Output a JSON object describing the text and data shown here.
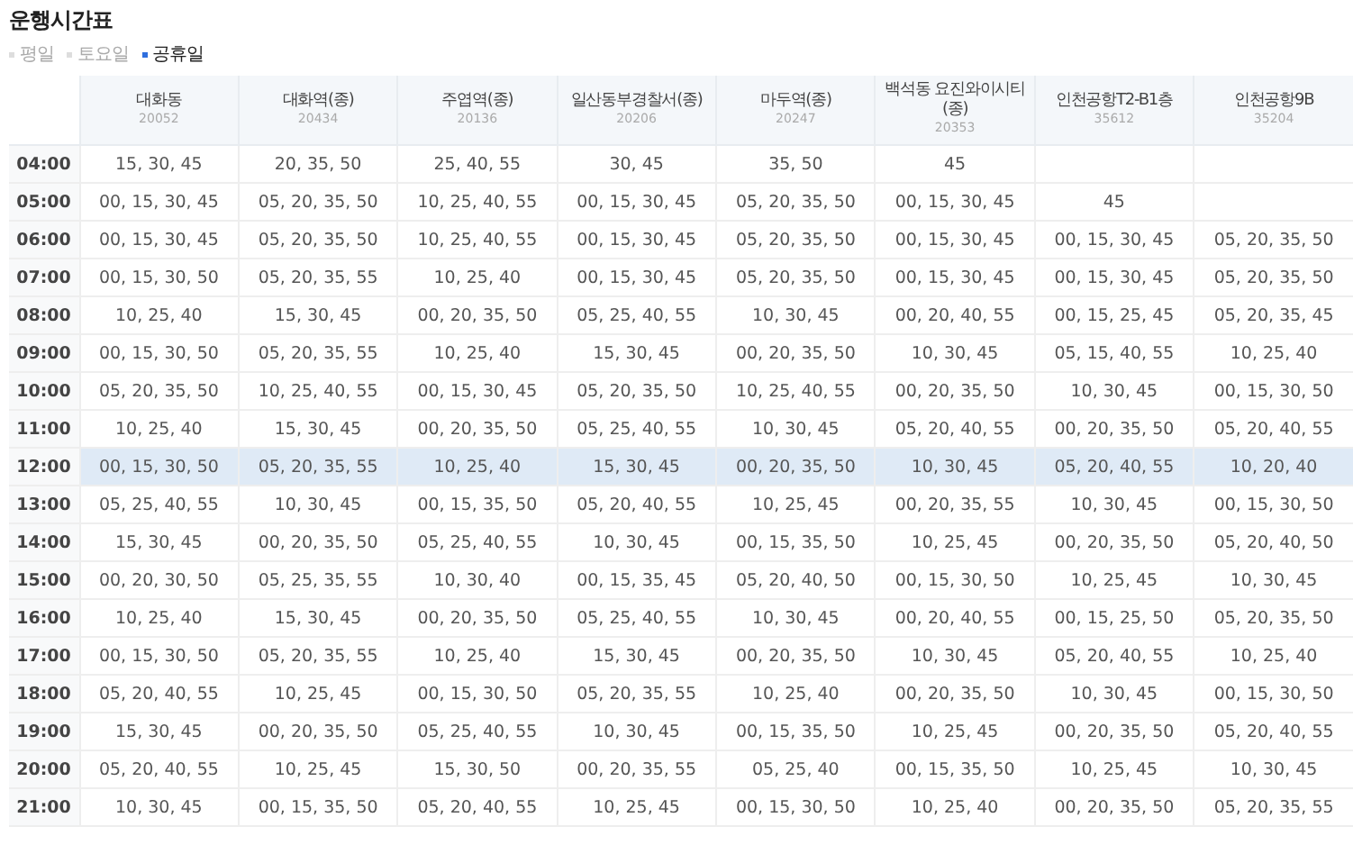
{
  "title": "운행시간표",
  "day_types": [
    {
      "label": "평일",
      "selected": false
    },
    {
      "label": "토요일",
      "selected": false
    },
    {
      "label": "공휴일",
      "selected": true
    }
  ],
  "table": {
    "columns": [
      {
        "name": "대화동",
        "stop_id": "20052"
      },
      {
        "name": "대화역(종)",
        "stop_id": "20434"
      },
      {
        "name": "주엽역(종)",
        "stop_id": "20136"
      },
      {
        "name": "일산동부경찰서(종)",
        "stop_id": "20206"
      },
      {
        "name": "마두역(종)",
        "stop_id": "20247"
      },
      {
        "name": "백석동 요진와이시티(종)",
        "stop_id": "20353"
      },
      {
        "name": "인천공항T2-B1층",
        "stop_id": "35612"
      },
      {
        "name": "인천공항9B",
        "stop_id": "35204"
      }
    ],
    "rows": [
      {
        "time": "04:00",
        "highlighted": false,
        "cells": [
          "15, 30, 45",
          "20, 35, 50",
          "25, 40, 55",
          "30, 45",
          "35, 50",
          "45",
          null,
          null
        ]
      },
      {
        "time": "05:00",
        "highlighted": false,
        "cells": [
          "00, 15, 30, 45",
          "05, 20, 35, 50",
          "10, 25, 40, 55",
          "00, 15, 30, 45",
          "05, 20, 35, 50",
          "00, 15, 30, 45",
          "45",
          null
        ]
      },
      {
        "time": "06:00",
        "highlighted": false,
        "cells": [
          "00, 15, 30, 45",
          "05, 20, 35, 50",
          "10, 25, 40, 55",
          "00, 15, 30, 45",
          "05, 20, 35, 50",
          "00, 15, 30, 45",
          "00, 15, 30, 45",
          "05, 20, 35, 50"
        ]
      },
      {
        "time": "07:00",
        "highlighted": false,
        "cells": [
          "00, 15, 30, 50",
          "05, 20, 35, 55",
          "10, 25, 40",
          "00, 15, 30, 45",
          "05, 20, 35, 50",
          "00, 15, 30, 45",
          "00, 15, 30, 45",
          "05, 20, 35, 50"
        ]
      },
      {
        "time": "08:00",
        "highlighted": false,
        "cells": [
          "10, 25, 40",
          "15, 30, 45",
          "00, 20, 35, 50",
          "05, 25, 40, 55",
          "10, 30, 45",
          "00, 20, 40, 55",
          "00, 15, 25, 45",
          "05, 20, 35, 45"
        ]
      },
      {
        "time": "09:00",
        "highlighted": false,
        "cells": [
          "00, 15, 30, 50",
          "05, 20, 35, 55",
          "10, 25, 40",
          "15, 30, 45",
          "00, 20, 35, 50",
          "10, 30, 45",
          "05, 15, 40, 55",
          "10, 25, 40"
        ]
      },
      {
        "time": "10:00",
        "highlighted": false,
        "cells": [
          "05, 20, 35, 50",
          "10, 25, 40, 55",
          "00, 15, 30, 45",
          "05, 20, 35, 50",
          "10, 25, 40, 55",
          "00, 20, 35, 50",
          "10, 30, 45",
          "00, 15, 30, 50"
        ]
      },
      {
        "time": "11:00",
        "highlighted": false,
        "cells": [
          "10, 25, 40",
          "15, 30, 45",
          "00, 20, 35, 50",
          "05, 25, 40, 55",
          "10, 30, 45",
          "05, 20, 40, 55",
          "00, 20, 35, 50",
          "05, 20, 40, 55"
        ]
      },
      {
        "time": "12:00",
        "highlighted": true,
        "cells": [
          "00, 15, 30, 50",
          "05, 20, 35, 55",
          "10, 25, 40",
          "15, 30, 45",
          "00, 20, 35, 50",
          "10, 30, 45",
          "05, 20, 40, 55",
          "10, 20, 40"
        ]
      },
      {
        "time": "13:00",
        "highlighted": false,
        "cells": [
          "05, 25, 40, 55",
          "10, 30, 45",
          "00, 15, 35, 50",
          "05, 20, 40, 55",
          "10, 25, 45",
          "00, 20, 35, 55",
          "10, 30, 45",
          "00, 15, 30, 50"
        ]
      },
      {
        "time": "14:00",
        "highlighted": false,
        "cells": [
          "15, 30, 45",
          "00, 20, 35, 50",
          "05, 25, 40, 55",
          "10, 30, 45",
          "00, 15, 35, 50",
          "10, 25, 45",
          "00, 20, 35, 50",
          "05, 20, 40, 50"
        ]
      },
      {
        "time": "15:00",
        "highlighted": false,
        "cells": [
          "00, 20, 30, 50",
          "05, 25, 35, 55",
          "10, 30, 40",
          "00, 15, 35, 45",
          "05, 20, 40, 50",
          "00, 15, 30, 50",
          "10, 25, 45",
          "10, 30, 45"
        ]
      },
      {
        "time": "16:00",
        "highlighted": false,
        "cells": [
          "10, 25, 40",
          "15, 30, 45",
          "00, 20, 35, 50",
          "05, 25, 40, 55",
          "10, 30, 45",
          "00, 20, 40, 55",
          "00, 15, 25, 50",
          "05, 20, 35, 50"
        ]
      },
      {
        "time": "17:00",
        "highlighted": false,
        "cells": [
          "00, 15, 30, 50",
          "05, 20, 35, 55",
          "10, 25, 40",
          "15, 30, 45",
          "00, 20, 35, 50",
          "10, 30, 45",
          "05, 20, 40, 55",
          "10, 25, 40"
        ]
      },
      {
        "time": "18:00",
        "highlighted": false,
        "cells": [
          "05, 20, 40, 55",
          "10, 25, 45",
          "00, 15, 30, 50",
          "05, 20, 35, 55",
          "10, 25, 40",
          "00, 20, 35, 50",
          "10, 30, 45",
          "00, 15, 30, 50"
        ]
      },
      {
        "time": "19:00",
        "highlighted": false,
        "cells": [
          "15, 30, 45",
          "00, 20, 35, 50",
          "05, 25, 40, 55",
          "10, 30, 45",
          "00, 15, 35, 50",
          "10, 25, 45",
          "00, 20, 35, 50",
          "05, 20, 40, 55"
        ]
      },
      {
        "time": "20:00",
        "highlighted": false,
        "cells": [
          "05, 20, 40, 55",
          "10, 25, 45",
          "15, 30, 50",
          "00, 20, 35, 55",
          "05, 25, 40",
          "00, 15, 35, 50",
          "10, 25, 45",
          "10, 30, 45"
        ]
      },
      {
        "time": "21:00",
        "highlighted": false,
        "cells": [
          "10, 30, 45",
          "00, 15, 35, 50",
          "05, 20, 40, 55",
          "10, 25, 45",
          "00, 15, 30, 50",
          "10, 25, 40",
          "00, 20, 35, 50",
          "05, 20, 35, 55"
        ]
      }
    ]
  }
}
